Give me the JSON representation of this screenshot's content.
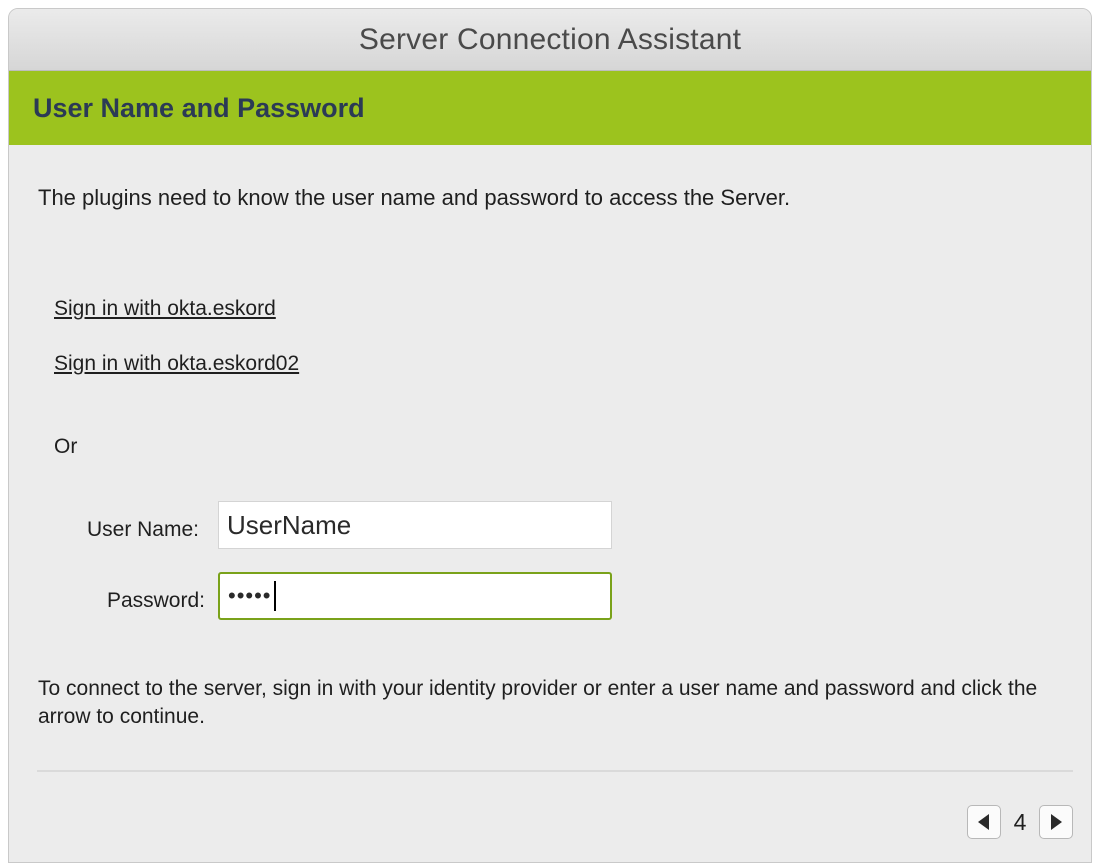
{
  "window": {
    "title": "Server Connection Assistant"
  },
  "banner": {
    "heading": "User Name and Password"
  },
  "main": {
    "intro": "The plugins need to know the user name and password to access the Server.",
    "sso_links": [
      {
        "label": "Sign in with okta.eskord"
      },
      {
        "label": "Sign in with okta.eskord02"
      }
    ],
    "or_label": "Or",
    "username": {
      "label": "User Name:",
      "value": "UserName"
    },
    "password": {
      "label": "Password:",
      "masked_value": "•••••"
    },
    "instructions": "To connect to the server, sign in with your identity provider or enter a user name and password and click the arrow to continue."
  },
  "pager": {
    "page": "4",
    "prev_icon": "triangle-left-icon",
    "next_icon": "triangle-right-icon"
  },
  "colors": {
    "banner": "#9cc31e",
    "heading": "#2b3a55",
    "focus_border": "#7aa21a"
  }
}
